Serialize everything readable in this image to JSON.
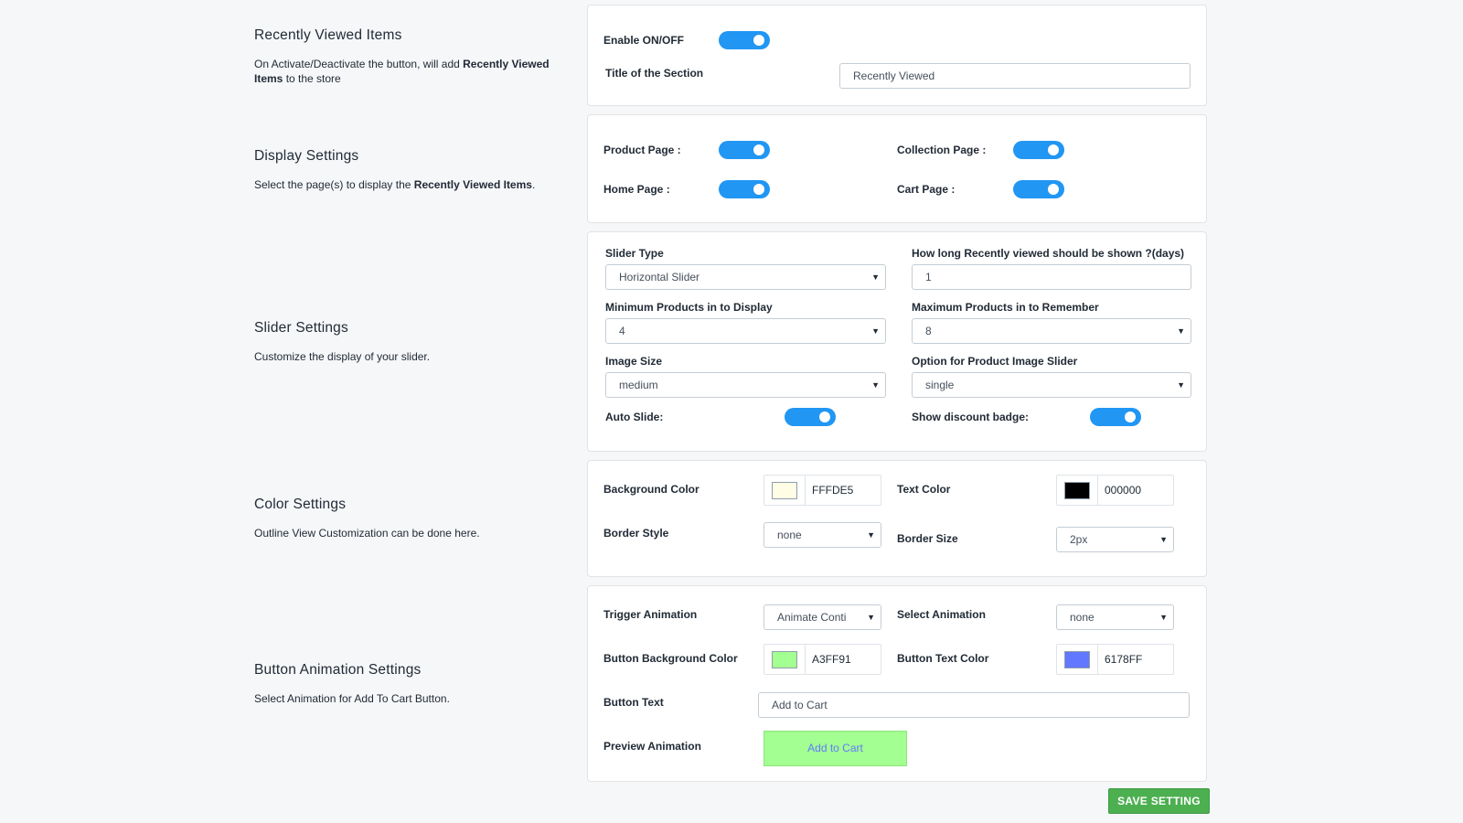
{
  "recently_viewed": {
    "title": "Recently Viewed Items",
    "desc_pre": "On Activate/Deactivate the button, will add ",
    "desc_bold": "Recently Viewed Items",
    "desc_post": " to the store",
    "enable_label": "Enable ON/OFF",
    "enable_on": true,
    "section_title_label": "Title of the Section",
    "section_title_value": "Recently Viewed"
  },
  "display": {
    "title": "Display Settings",
    "desc_pre": "Select the page(s) to display the ",
    "desc_bold": "Recently Viewed Items",
    "desc_post": ".",
    "product_page_label": "Product Page :",
    "collection_page_label": "Collection Page :",
    "home_page_label": "Home Page :",
    "cart_page_label": "Cart Page :"
  },
  "slider": {
    "title": "Slider Settings",
    "desc": "Customize the display of your slider.",
    "slider_type_label": "Slider Type",
    "slider_type_value": "Horizontal Slider",
    "days_label": "How long Recently viewed should be shown ?(days)",
    "days_value": "1",
    "min_products_label": "Minimum Products in to Display",
    "min_products_value": "4",
    "max_products_label": "Maximum Products in to Remember",
    "max_products_value": "8",
    "image_size_label": "Image Size",
    "image_size_value": "medium",
    "image_slider_label": "Option for Product Image Slider",
    "image_slider_value": "single",
    "auto_slide_label": "Auto Slide:",
    "discount_badge_label": "Show discount badge:"
  },
  "color": {
    "title": "Color Settings",
    "desc": "Outline View Customization can be done here.",
    "bg_color_label": "Background Color",
    "bg_color_value": "FFFDE5",
    "bg_color_hex": "#FFFDE5",
    "text_color_label": "Text Color",
    "text_color_value": "000000",
    "text_color_hex": "#000000",
    "border_style_label": "Border Style",
    "border_style_value": "none",
    "border_size_label": "Border Size",
    "border_size_value": "2px"
  },
  "button_anim": {
    "title": "Button Animation Settings",
    "desc": "Select Animation for Add To Cart Button.",
    "trigger_label": "Trigger Animation",
    "trigger_value": "Animate Conti",
    "select_anim_label": "Select Animation",
    "select_anim_value": "none",
    "btn_bg_label": "Button Background Color",
    "btn_bg_value": "A3FF91",
    "btn_bg_hex": "#A3FF91",
    "btn_text_label": "Button Text Color",
    "btn_text_value": "6178FF",
    "btn_text_hex": "#6178FF",
    "button_text_label": "Button Text",
    "button_text_value": "Add to Cart",
    "preview_label": "Preview Animation",
    "preview_button": "Add to Cart"
  },
  "save_button": "SAVE SETTING",
  "icons": {
    "caret": "caret-down-icon"
  },
  "colors": {
    "toggle_on": "#2196F3",
    "save": "#4CAF50"
  }
}
